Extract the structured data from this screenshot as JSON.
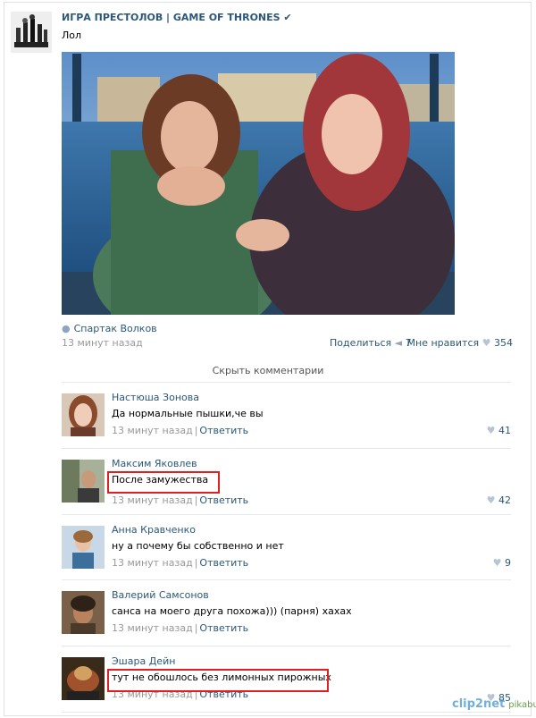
{
  "post": {
    "group_name": "ИГРА ПРЕСТОЛОВ | GAME OF THRONES",
    "verified_mark": "✔",
    "text": "Лол",
    "signer": "Спартак Волков",
    "time": "13 минут назад",
    "share_label": "Поделиться",
    "share_count": "7",
    "like_label": "Мне нравится",
    "like_count": "354"
  },
  "hide_comments_label": "Скрыть комментарии",
  "reply_label": "Ответить",
  "comments": [
    {
      "author": "Настюша Зонова",
      "text": "Да нормальные пышки,че вы",
      "time": "13 минут назад",
      "likes": "41"
    },
    {
      "author": "Максим Яковлев",
      "text": "После замужества",
      "time": "13 минут назад",
      "likes": "42"
    },
    {
      "author": "Анна Кравченко",
      "text": "ну а почему бы собственно и нет",
      "time": "13 минут назад",
      "likes": "9"
    },
    {
      "author": "Валерий Самсонов",
      "text": "санса на моего друга похожа))) (парня) хахах",
      "time": "13 минут назад",
      "likes": ""
    },
    {
      "author": "Эшара Дейн",
      "text": "тут не обошлось без лимонных пирожных",
      "time": "13 минут назад",
      "likes": "85"
    }
  ],
  "watermark": {
    "left": "clip2net",
    "right": "pikabu.ru"
  },
  "colors": {
    "link": "#2b587a",
    "muted": "#999999",
    "highlight_box": "#e02020"
  }
}
